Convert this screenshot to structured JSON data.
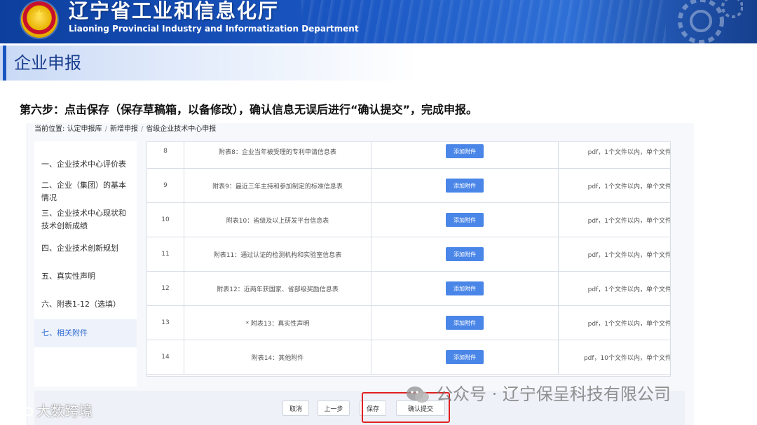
{
  "header": {
    "title_cn": "辽宁省工业和信息化厅",
    "title_en": "Liaoning Provincial Industry and Informatization Department"
  },
  "section": {
    "title": "企业申报"
  },
  "instruction": "第六步：点击保存（保存草稿箱，以备修改），确认信息无误后进行“确认提交”，完成申报。",
  "breadcrumb": {
    "prefix": "当前位置:",
    "items": [
      "认定申报库",
      "新增申报",
      "省级企业技术中心申报"
    ]
  },
  "sidebar": {
    "items": [
      {
        "label": "一、企业技术中心评价表"
      },
      {
        "label": "二、企业（集团）的基本情况"
      },
      {
        "label": "三、企业技术中心现状和技术创新成绩"
      },
      {
        "label": "四、企业技术创新规划"
      },
      {
        "label": "五、真实性声明"
      },
      {
        "label": "六、附表1-12（选填）"
      },
      {
        "label": "七、相关附件"
      }
    ],
    "active_index": 6
  },
  "attachments": {
    "button_label": "添加附件",
    "rows": [
      {
        "no": "8",
        "name": "附表8：企业当年被受理的专利申请信息表",
        "note": "pdf，1个文件以内，单个文件"
      },
      {
        "no": "9",
        "name": "附表9：最近三年主持和参加制定的标准信息表",
        "note": "pdf，1个文件以内，单个文件"
      },
      {
        "no": "10",
        "name": "附表10：省级及以上研发平台信息表",
        "note": "pdf，1个文件以内，单个文件"
      },
      {
        "no": "11",
        "name": "附表11：通过认证的检测机构和实验室信息表",
        "note": "pdf，1个文件以内，单个文件"
      },
      {
        "no": "12",
        "name": "附表12：近两年获国家、省部级奖励信息表",
        "note": "pdf，1个文件以内，单个文件"
      },
      {
        "no": "13",
        "name": "* 附表13：真实性声明",
        "note": "pdf，1个文件以内，单个文件"
      },
      {
        "no": "14",
        "name": "附表14：其他附件",
        "note": "pdf，10个文件以内，单个文件"
      }
    ]
  },
  "actions": {
    "cancel": "取消",
    "prev": "上一步",
    "save": "保存",
    "submit": "确认提交"
  },
  "watermarks": {
    "right": "公众号 · 辽宁保呈科技有限公司",
    "left": "大数跨境"
  },
  "colors": {
    "banner": "#1a56c2",
    "accent": "#4a86e8",
    "highlight": "#e02020"
  }
}
